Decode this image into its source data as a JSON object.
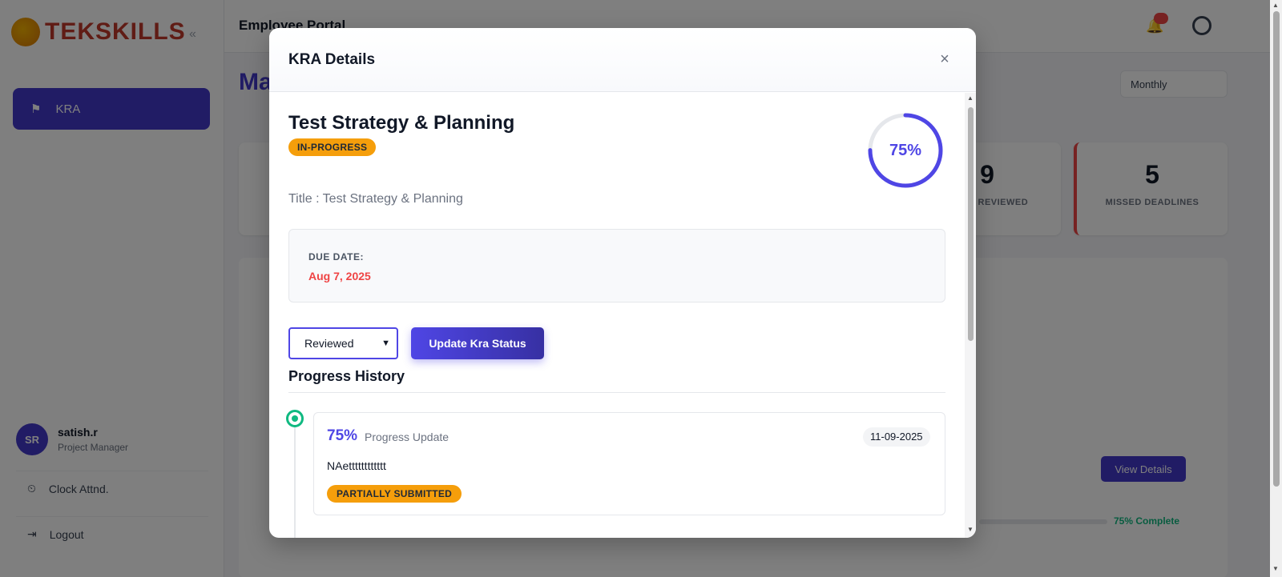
{
  "app": {
    "logo_text": "TEKSKILLS",
    "collapse_glyph": "«",
    "header_title": "Employee Portal",
    "page_heading": "Ma",
    "month_select": "Monthly",
    "nav_active": {
      "icon": "flag-icon",
      "glyph": "⚑",
      "label": "KRA"
    },
    "profile": {
      "initials": "SR",
      "name": "satish.r",
      "role": "Project Manager"
    },
    "side_links": [
      {
        "icon": "clock-icon",
        "glyph": "⏲",
        "label": "Clock Attnd."
      },
      {
        "icon": "logout-icon",
        "glyph": "⇥",
        "label": "Logout"
      }
    ],
    "stats": [
      {
        "value": "9",
        "label": "ITEMS REVIEWED"
      },
      {
        "value": "5",
        "label": "MISSED DEADLINES"
      }
    ],
    "view_details_label": "View Details",
    "complete_label": "75% Complete",
    "notif_glyph": "🔔"
  },
  "modal": {
    "title": "KRA Details",
    "close_glyph": "×",
    "kra_name": "Test Strategy & Planning",
    "status": "IN-PROGRESS",
    "progress_label": "75%",
    "progress_value": 0.75,
    "title_line": "Title : Test Strategy & Planning",
    "due_label": "DUE DATE:",
    "due_value": "Aug 7, 2025",
    "status_select": {
      "selected": "Reviewed"
    },
    "update_button": "Update Kra Status",
    "history_title": "Progress History",
    "history": [
      {
        "percent": "75%",
        "type": "Progress Update",
        "date": "11-09-2025",
        "note": "NAetttttttttttt",
        "badge": "PARTIALLY SUBMITTED"
      }
    ]
  },
  "colors": {
    "accent": "#4f46e5",
    "status_amber": "#f59e0b",
    "due_red": "#ef4444",
    "timeline_green": "#10b981"
  }
}
